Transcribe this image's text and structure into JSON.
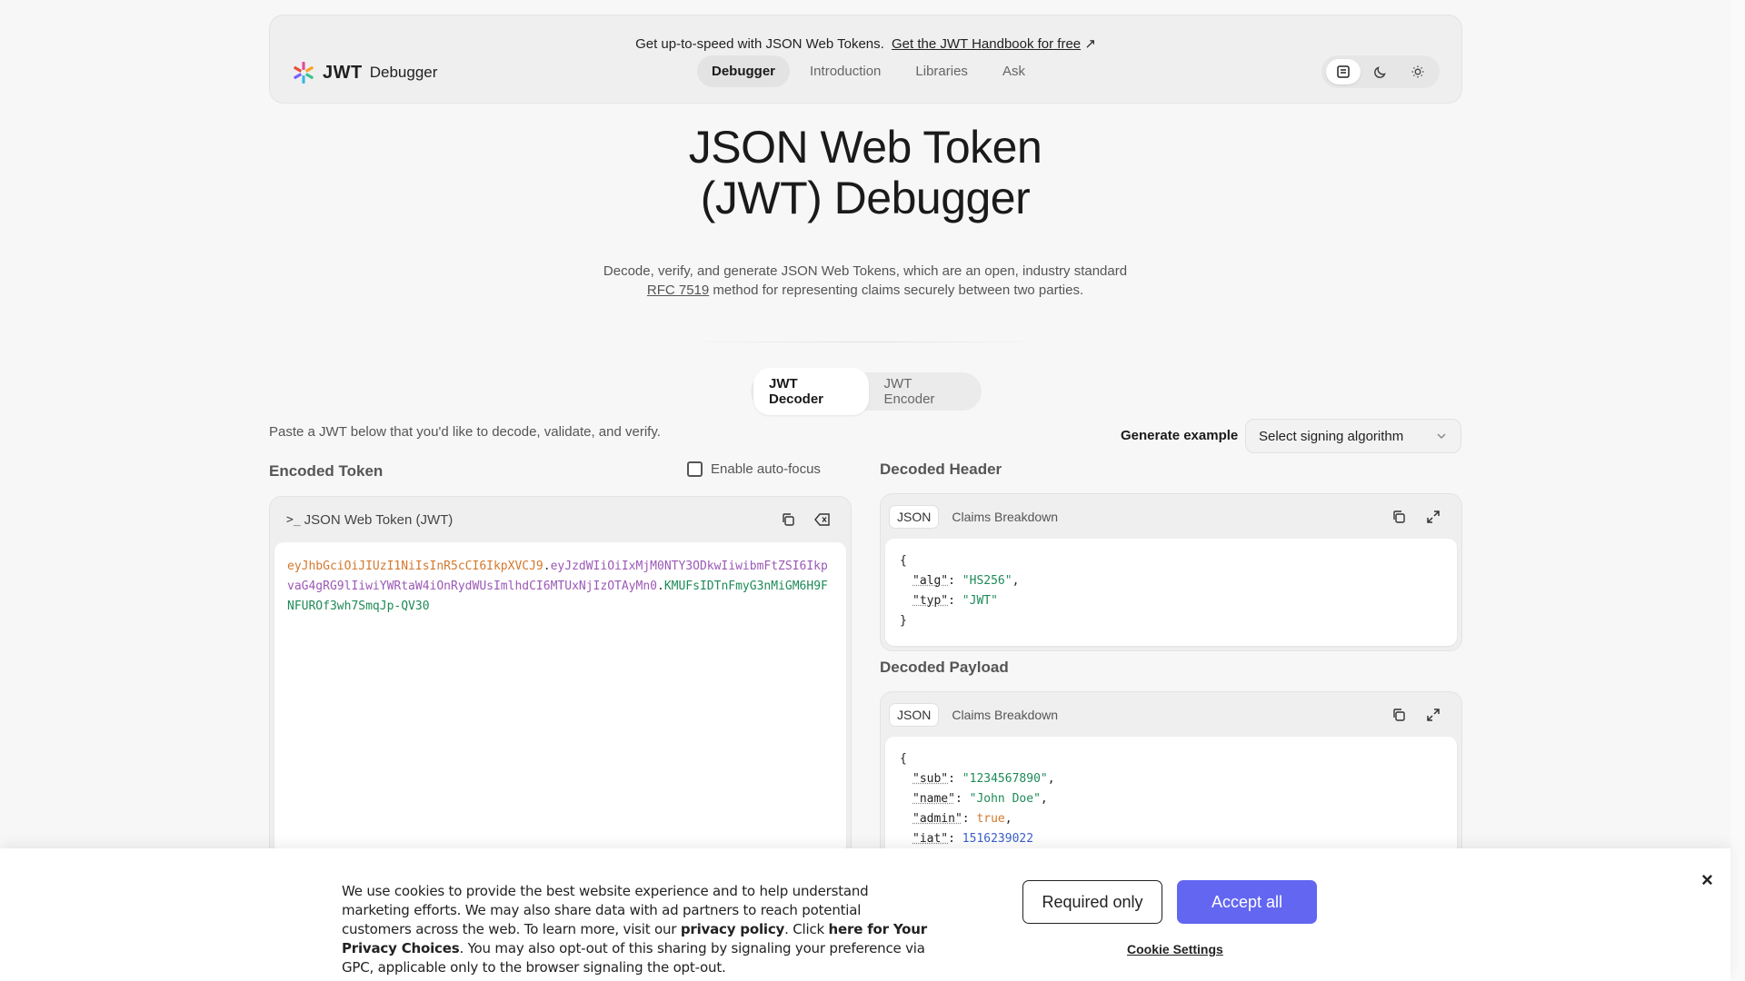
{
  "banner": {
    "text": "Get up-to-speed with JSON Web Tokens.",
    "link": "Get the JWT Handbook for free"
  },
  "brand": {
    "name": "JWT",
    "subtitle": "Debugger"
  },
  "nav": [
    {
      "label": "Debugger"
    },
    {
      "label": "Introduction"
    },
    {
      "label": "Libraries"
    },
    {
      "label": "Ask"
    }
  ],
  "theme_icons": [
    "system-icon",
    "moon-icon",
    "sun-icon"
  ],
  "hero": {
    "title_line1": "JSON Web Token",
    "title_line2": "(JWT) Debugger",
    "desc_line1": "Decode, verify, and generate JSON Web Tokens, which are an open, industry standard",
    "desc_link": "RFC 7519",
    "desc_line2": " method for representing claims securely between two parties."
  },
  "mode_tabs": [
    {
      "label": "JWT Decoder"
    },
    {
      "label": "JWT Encoder"
    }
  ],
  "hint": "Paste a JWT below that you'd like to decode, validate, and verify.",
  "generate": {
    "label": "Generate example",
    "select_value": "Select signing algorithm"
  },
  "encoded": {
    "title": "Encoded Token",
    "autofocus_label": "Enable auto-focus",
    "panel_label": "JSON Web Token (JWT)",
    "token_header": "eyJhbGciOiJIUzI1NiIsInR5cCI6IkpXVCJ9",
    "token_payload": "eyJzdWIiOiIxMjM0NTY3ODkwIiwibmFtZSI6IkpvaG4gRG9lIiwiYWRtaW4iOnRydWUsImlhdCI6MTUxNjIzOTAyMn0",
    "token_signature": "KMUFsIDTnFmyG3nMiGM6H9FNFUROf3wh7SmqJp-QV30",
    "dot": "."
  },
  "decoded_header": {
    "title": "Decoded Header",
    "tab_json": "JSON",
    "tab_claims": "Claims Breakdown",
    "lines": {
      "open": "{",
      "alg_key": "\"alg\"",
      "alg_val": "\"HS256\"",
      "typ_key": "\"typ\"",
      "typ_val": "\"JWT\"",
      "close": "}"
    }
  },
  "decoded_payload": {
    "title": "Decoded Payload",
    "tab_json": "JSON",
    "tab_claims": "Claims Breakdown",
    "lines": {
      "open": "{",
      "sub_key": "\"sub\"",
      "sub_val": "\"1234567890\"",
      "name_key": "\"name\"",
      "name_val": "\"John Doe\"",
      "admin_key": "\"admin\"",
      "admin_val": "true",
      "iat_key": "\"iat\"",
      "iat_val": "1516239022"
    }
  },
  "cookie": {
    "text_1": "We use cookies to provide the best website experience and to help understand marketing efforts. We may also share data with ad partners to reach potential customers across the web. To learn more, visit our ",
    "privacy_link": "privacy policy",
    "text_2": ". Click ",
    "choices_link": "here for Your Privacy Choices",
    "text_3": ". You may also opt-out of this sharing by signaling your preference via GPC, applicable only to the browser signaling the opt-out.",
    "required_btn": "Required only",
    "accept_btn": "Accept all",
    "settings_link": "Cookie Settings",
    "close": "×"
  },
  "colors": {
    "accent": "#6366f1",
    "token_header": "#d4782c",
    "token_payload": "#9b59b6",
    "token_signature": "#1e8a58"
  }
}
